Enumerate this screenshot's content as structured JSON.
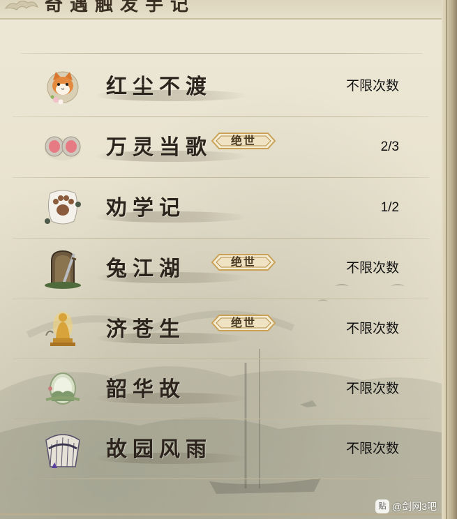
{
  "header": {
    "title": "奇遇触发手记"
  },
  "rows": [
    {
      "name": "红尘不渡",
      "count": "不限次数",
      "icon": "cat-icon",
      "badge": ""
    },
    {
      "name": "万灵当歌",
      "count": "2/3",
      "icon": "mouse-ears-icon",
      "badge": "绝世"
    },
    {
      "name": "劝学记",
      "count": "1/2",
      "icon": "paw-icon",
      "badge": ""
    },
    {
      "name": "兔江湖",
      "count": "不限次数",
      "icon": "door-sword-icon",
      "badge": "绝世"
    },
    {
      "name": "济苍生",
      "count": "不限次数",
      "icon": "buddha-icon",
      "badge": "绝世"
    },
    {
      "name": "韶华故",
      "count": "不限次数",
      "icon": "egg-landscape-icon",
      "badge": ""
    },
    {
      "name": "故园风雨",
      "count": "不限次数",
      "icon": "folding-fan-icon",
      "badge": ""
    }
  ],
  "watermark": {
    "icon_label": "贴",
    "text": "@剑网3吧"
  },
  "colors": {
    "panel_bg": "#e9e3cf",
    "text_dark": "#2c241c",
    "badge_gold": "#c9a257"
  }
}
